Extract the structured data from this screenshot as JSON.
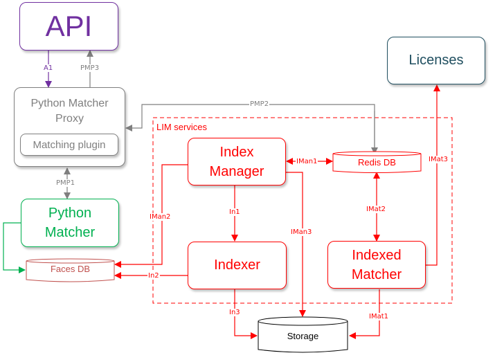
{
  "colors": {
    "api": "#7030a0",
    "proxy": "#7f7f7f",
    "python_matcher": "#00b050",
    "lim": "#ff0000",
    "licenses": "#1f4e5f",
    "faces_db": "#c0504d",
    "storage": "#000000"
  },
  "nodes": {
    "api": "API",
    "proxy_line1": "Python Matcher",
    "proxy_line2": "Proxy",
    "matching_plugin": "Matching plugin",
    "python_matcher_line1": "Python",
    "python_matcher_line2": "Matcher",
    "faces_db": "Faces DB",
    "lim_group": "LIM services",
    "index_manager_line1": "Index",
    "index_manager_line2": "Manager",
    "indexer": "Indexer",
    "redis_db": "Redis DB",
    "indexed_matcher_line1": "Indexed",
    "indexed_matcher_line2": "Matcher",
    "licenses": "Licenses",
    "storage": "Storage"
  },
  "edges": {
    "a1": "A1",
    "pmp3": "PMP3",
    "pmp1": "PMP1",
    "pmp2": "PMP2",
    "iman1": "IMan1",
    "iman2": "IMan2",
    "iman3": "IMan3",
    "in1": "In1",
    "in2": "In2",
    "in3": "In3",
    "imat1": "IMat1",
    "imat2": "IMat2",
    "imat3": "IMat3"
  }
}
